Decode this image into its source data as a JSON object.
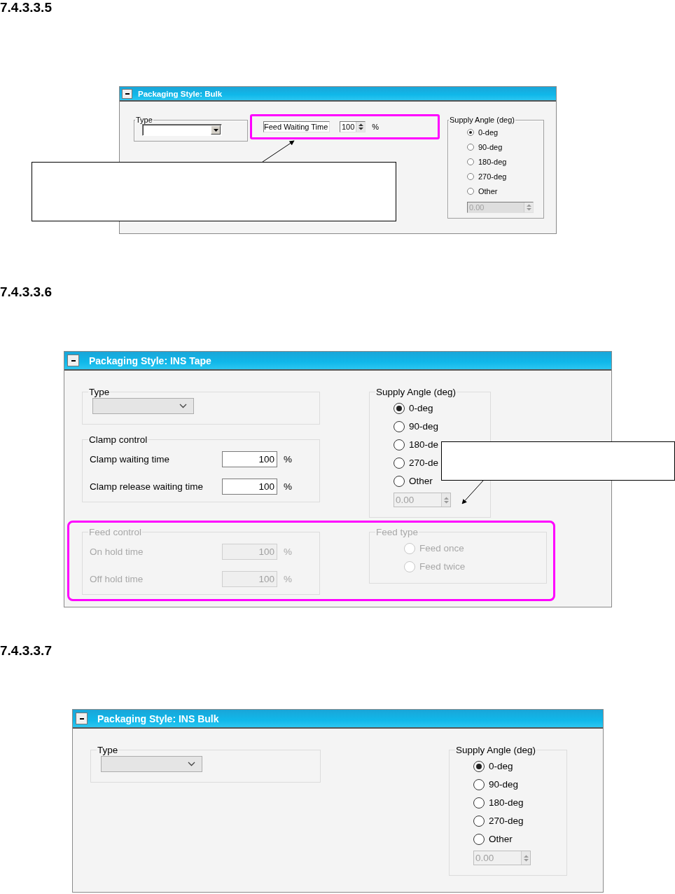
{
  "sections": [
    {
      "heading": "7.4.3.3.5",
      "panel": {
        "title": "Packaging Style: Bulk",
        "rows": [
          {
            "highlighted": false,
            "columns": [
              [
                {
                  "kind": "dropdown",
                  "legend": "Type",
                  "disabled": false
                }
              ],
              [
                {
                  "kind": "fields",
                  "highlighted": true,
                  "disabled": false,
                  "fields": [
                    {
                      "kind": "spin",
                      "label": "Feed Waiting Time",
                      "value": "100",
                      "unit": "%"
                    }
                  ]
                }
              ],
              [
                {
                  "kind": "radios",
                  "legend": "Supply Angle (deg)",
                  "disabled": false,
                  "options": [
                    {
                      "label": "0-deg",
                      "selected": true
                    },
                    {
                      "label": "90-deg",
                      "selected": false
                    },
                    {
                      "label": "180-deg",
                      "selected": false
                    },
                    {
                      "label": "270-deg",
                      "selected": false
                    },
                    {
                      "label": "Other",
                      "selected": false
                    }
                  ],
                  "spin": {
                    "value": "0.00",
                    "disabled": true
                  }
                }
              ]
            ]
          }
        ]
      }
    },
    {
      "heading": "7.4.3.3.6",
      "panel": {
        "title": "Packaging Style: INS Tape",
        "rows": [
          {
            "highlighted": false,
            "columns": [
              [
                {
                  "kind": "dropdown",
                  "legend": "Type",
                  "disabled": true
                },
                {
                  "kind": "fields",
                  "legend": "Clamp control",
                  "highlighted": false,
                  "disabled": false,
                  "fields": [
                    {
                      "kind": "plain",
                      "label": "Clamp waiting time",
                      "value": "100",
                      "unit": "%"
                    },
                    {
                      "kind": "plain",
                      "label": "Clamp release waiting time",
                      "value": "100",
                      "unit": "%"
                    }
                  ]
                }
              ],
              [
                {
                  "kind": "radios",
                  "legend": "Supply Angle (deg)",
                  "disabled": false,
                  "options": [
                    {
                      "label": "0-deg",
                      "selected": true
                    },
                    {
                      "label": "90-deg",
                      "selected": false
                    },
                    {
                      "label": "180-de",
                      "selected": false
                    },
                    {
                      "label": "270-de",
                      "selected": false
                    },
                    {
                      "label": "Other",
                      "selected": false
                    }
                  ],
                  "spin": {
                    "value": "0.00",
                    "disabled": true
                  }
                }
              ]
            ]
          },
          {
            "highlighted": true,
            "columns": [
              [
                {
                  "kind": "fields",
                  "legend": "Feed control",
                  "highlighted": false,
                  "disabled": true,
                  "fields": [
                    {
                      "kind": "plain",
                      "label": "On hold time",
                      "value": "100",
                      "unit": "%"
                    },
                    {
                      "kind": "plain",
                      "label": "Off hold time",
                      "value": "100",
                      "unit": "%"
                    }
                  ]
                }
              ],
              [
                {
                  "kind": "radios",
                  "legend": "Feed type",
                  "disabled": true,
                  "options": [
                    {
                      "label": "Feed once",
                      "selected": false
                    },
                    {
                      "label": "Feed twice",
                      "selected": false
                    }
                  ]
                }
              ]
            ]
          }
        ]
      }
    },
    {
      "heading": "7.4.3.3.7",
      "panel": {
        "title": "Packaging Style: INS Bulk",
        "rows": [
          {
            "highlighted": false,
            "columns": [
              [
                {
                  "kind": "dropdown",
                  "legend": "Type",
                  "disabled": true
                }
              ],
              [
                {
                  "kind": "radios",
                  "legend": "Supply Angle (deg)",
                  "disabled": false,
                  "options": [
                    {
                      "label": "0-deg",
                      "selected": true
                    },
                    {
                      "label": "90-deg",
                      "selected": false
                    },
                    {
                      "label": "180-deg",
                      "selected": false
                    },
                    {
                      "label": "270-deg",
                      "selected": false
                    },
                    {
                      "label": "Other",
                      "selected": false
                    }
                  ],
                  "spin": {
                    "value": "0.00",
                    "disabled": true
                  }
                }
              ]
            ]
          }
        ]
      }
    }
  ]
}
